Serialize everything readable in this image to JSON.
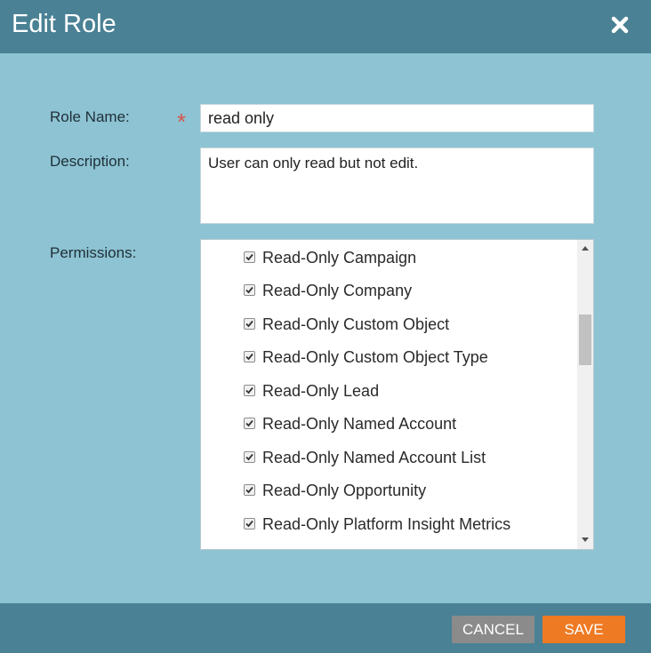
{
  "dialog": {
    "title": "Edit Role"
  },
  "form": {
    "role_name_label": "Role Name:",
    "required_marker": "*",
    "role_name_value": "read only",
    "description_label": "Description:",
    "description_value": "User can only read but not edit.",
    "permissions_label": "Permissions:"
  },
  "permissions": {
    "items": [
      {
        "label": "Read-Only Campaign",
        "checked": true
      },
      {
        "label": "Read-Only Company",
        "checked": true
      },
      {
        "label": "Read-Only Custom Object",
        "checked": true
      },
      {
        "label": "Read-Only Custom Object Type",
        "checked": true
      },
      {
        "label": "Read-Only Lead",
        "checked": true
      },
      {
        "label": "Read-Only Named Account",
        "checked": true
      },
      {
        "label": "Read-Only Named Account List",
        "checked": true
      },
      {
        "label": "Read-Only Opportunity",
        "checked": true
      },
      {
        "label": "Read-Only Platform Insight Metrics",
        "checked": true
      }
    ]
  },
  "footer": {
    "cancel_label": "CANCEL",
    "save_label": "SAVE"
  },
  "colors": {
    "header": "#4a8195",
    "body": "#8dc3d2",
    "save": "#ee7a23",
    "cancel": "#8b8b8b",
    "required": "#d7564d"
  },
  "icons": {
    "close": "close-icon",
    "checkbox": "checkmark-icon",
    "scroll_up": "arrow-up-icon",
    "scroll_down": "arrow-down-icon"
  }
}
